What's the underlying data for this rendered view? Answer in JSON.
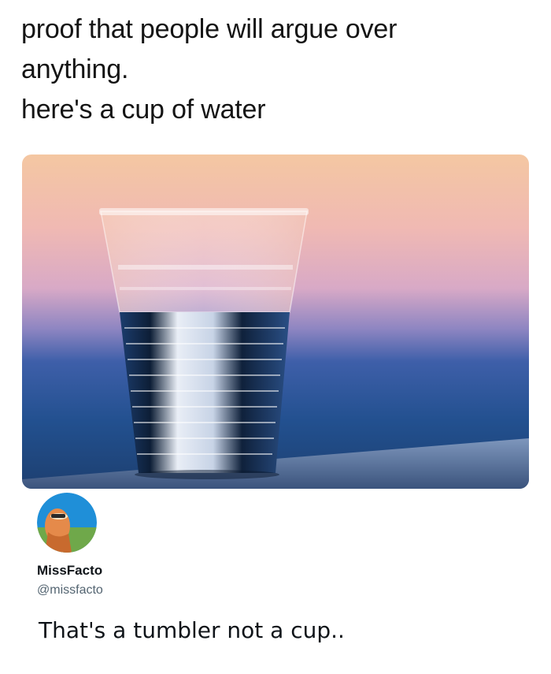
{
  "post": {
    "lines": [
      "proof that people will argue over",
      "anything.",
      "here's a cup of water"
    ]
  },
  "image": {
    "subject": "clear plastic cup half filled with water against a sunset sky"
  },
  "reply": {
    "display_name": "MissFacto",
    "handle": "@missfacto",
    "text": "That's a tumbler not a cup..",
    "avatar_icon": "profile-avatar"
  },
  "colors": {
    "sky_top": "#f2c6a0",
    "sky_mid": "#d9a7c7",
    "sky_low": "#3f5fa8",
    "sea": "#1f4c8a",
    "handle_gray": "#536471"
  }
}
